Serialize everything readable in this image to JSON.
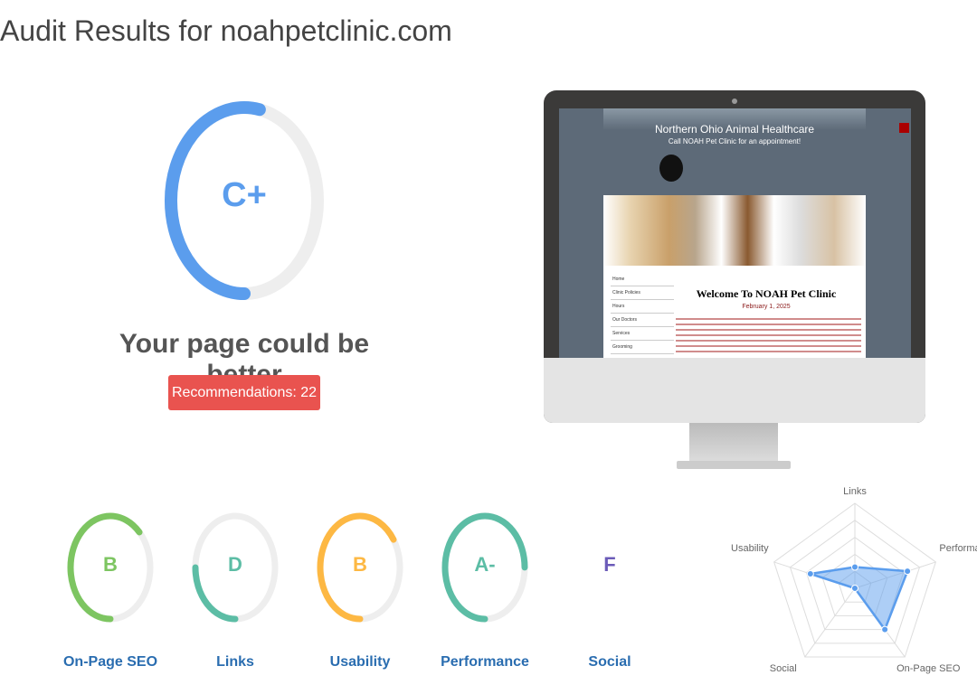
{
  "title": "Audit Results for noahpetclinic.com",
  "overall": {
    "grade": "C+",
    "score": 0.53,
    "color": "#5b9ded",
    "headline": "Your page could be better",
    "recommendations": "Recommendations: 22"
  },
  "categories": [
    {
      "label": "On-Page SEO",
      "grade": "B",
      "score": 0.62,
      "color": "#7dc561"
    },
    {
      "label": "Links",
      "grade": "D",
      "score": 0.25,
      "color": "#5cbda5"
    },
    {
      "label": "Usability",
      "grade": "B",
      "score": 0.65,
      "color": "#fdb843"
    },
    {
      "label": "Performance",
      "grade": "A-",
      "score": 0.75,
      "color": "#5cbda5"
    },
    {
      "label": "Social",
      "grade": "F",
      "score": 0,
      "color": "#6b5bb8"
    }
  ],
  "preview": {
    "site_title": "Northern Ohio Animal Healthcare",
    "site_subtitle": "Call NOAH Pet Clinic for an appointment!",
    "welcome": "Welcome To NOAH Pet Clinic",
    "date": "February 1, 2025",
    "nav": [
      "Home",
      "Clinic Policies",
      "Hours",
      "Our Doctors",
      "Services",
      "Grooming"
    ]
  },
  "chart_data": {
    "type": "radar",
    "axes": [
      "Links",
      "Performance",
      "On-Page SEO",
      "Social",
      "Usability"
    ],
    "values": [
      25,
      65,
      60,
      0,
      55
    ],
    "range": [
      0,
      100
    ],
    "color": "#5b9ded"
  }
}
